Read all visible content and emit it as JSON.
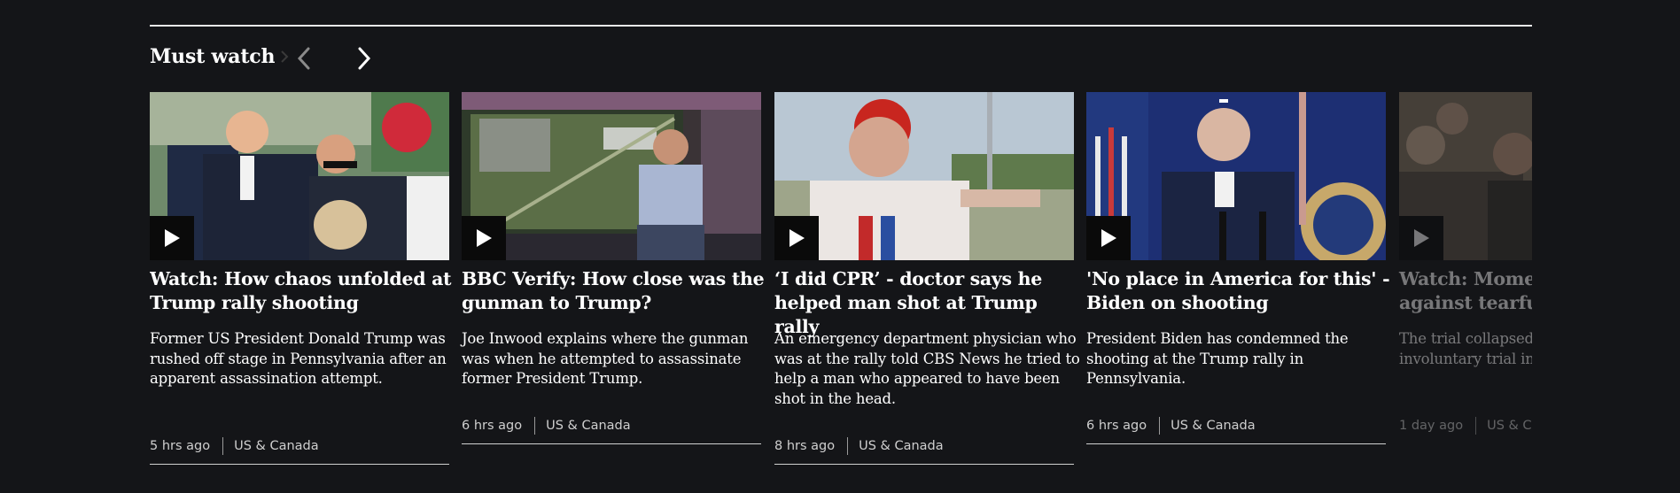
{
  "section": {
    "title": "Must watch",
    "icons": {
      "title_chevron": "chevron-right-icon",
      "prev": "chevron-left-icon",
      "next": "chevron-right-icon",
      "play": "play-icon"
    }
  },
  "cards": [
    {
      "headline": "Watch: How chaos unfolded at Trump rally shooting",
      "summary": "Former US President Donald Trump was rushed off stage in Pennsylvania after an apparent assassination attempt.",
      "time": "5 hrs ago",
      "category": "US & Canada"
    },
    {
      "headline": "BBC Verify: How close was the gunman to Trump?",
      "summary": "Joe Inwood explains where the gunman was when he attempted to assassinate former President Trump.",
      "time": "6 hrs ago",
      "category": "US & Canada"
    },
    {
      "headline": "‘I did CPR’ - doctor says he helped man shot at Trump rally",
      "summary": "An emergency department physician who was at the rally told CBS News he tried to help a man who appeared to have been shot in the head.",
      "time": "8 hrs ago",
      "category": "US & Canada"
    },
    {
      "headline": "'No place in America for this' - Biden on shooting",
      "summary": "President Biden has condemned the shooting at the Trump rally in Pennsylvania.",
      "time": "6 hrs ago",
      "category": "US & Canada"
    },
    {
      "headline": "Watch: Moments of tension against tearful",
      "summary": "The trial collapsed into US actor's involuntary trial in New Mexico",
      "time": "1 day ago",
      "category": "US & Canada"
    }
  ]
}
